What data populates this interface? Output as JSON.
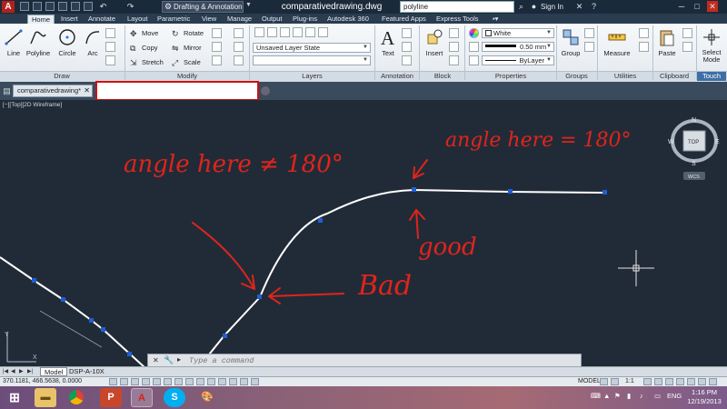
{
  "titlebar": {
    "workspace": "Drafting & Annotation",
    "document_title": "comparativedrawing.dwg",
    "search_value": "polyline",
    "sign_in": "Sign In"
  },
  "ribbon_tabs": [
    "Home",
    "Insert",
    "Annotate",
    "Layout",
    "Parametric",
    "View",
    "Manage",
    "Output",
    "Plug-ins",
    "Autodesk 360",
    "Featured Apps",
    "Express Tools"
  ],
  "draw_panel": {
    "label": "Draw",
    "tools": [
      "Line",
      "Polyline",
      "Circle",
      "Arc"
    ]
  },
  "modify_panel": {
    "label": "Modify",
    "tools": [
      "Move",
      "Rotate",
      "Copy",
      "Mirror",
      "Stretch",
      "Scale"
    ]
  },
  "layers_panel": {
    "label": "Layers",
    "layer_state": "Unsaved Layer State"
  },
  "annotation_panel": {
    "label": "Annotation",
    "text": "Text"
  },
  "block_panel": {
    "label": "Block",
    "insert": "Insert"
  },
  "properties_panel": {
    "label": "Properties",
    "color": "White",
    "lineweight": "0.50 mm",
    "linetype": "ByLayer"
  },
  "groups_panel": {
    "label": "Groups",
    "group": "Group"
  },
  "utilities_panel": {
    "label": "Utilities",
    "measure": "Measure"
  },
  "clipboard_panel": {
    "label": "Clipboard",
    "paste": "Paste"
  },
  "touch_panel": {
    "label": "Touch",
    "select_mode_1": "Select",
    "select_mode_2": "Mode"
  },
  "doc_tab": {
    "name": "comparativedrawing*"
  },
  "viewport": {
    "label": "[−][Top][2D Wireframe]",
    "viewcube": {
      "top": "TOP",
      "n": "N",
      "s": "S",
      "e": "E",
      "w": "W",
      "wcs": "WCS"
    }
  },
  "annotations": {
    "angle_not": "angle here ≠ 180°",
    "angle_eq": "angle here = 180°",
    "bad": "Bad",
    "good": "good"
  },
  "command_line": {
    "placeholder": "Type a command"
  },
  "layout_tabs": [
    "Model",
    "DSP-A-10X"
  ],
  "status_bar": {
    "coordinates": "370.1181, 466.5638, 0.0000",
    "model": "MODEL",
    "scale": "1:1"
  },
  "taskbar": {
    "language": "ENG",
    "time": "1:16 PM",
    "date": "12/19/2013"
  },
  "colors": {
    "canvas": "#212b37",
    "annotation": "#e0241c",
    "grip": "#1f5fd6",
    "highlight_box": "#d01010"
  }
}
